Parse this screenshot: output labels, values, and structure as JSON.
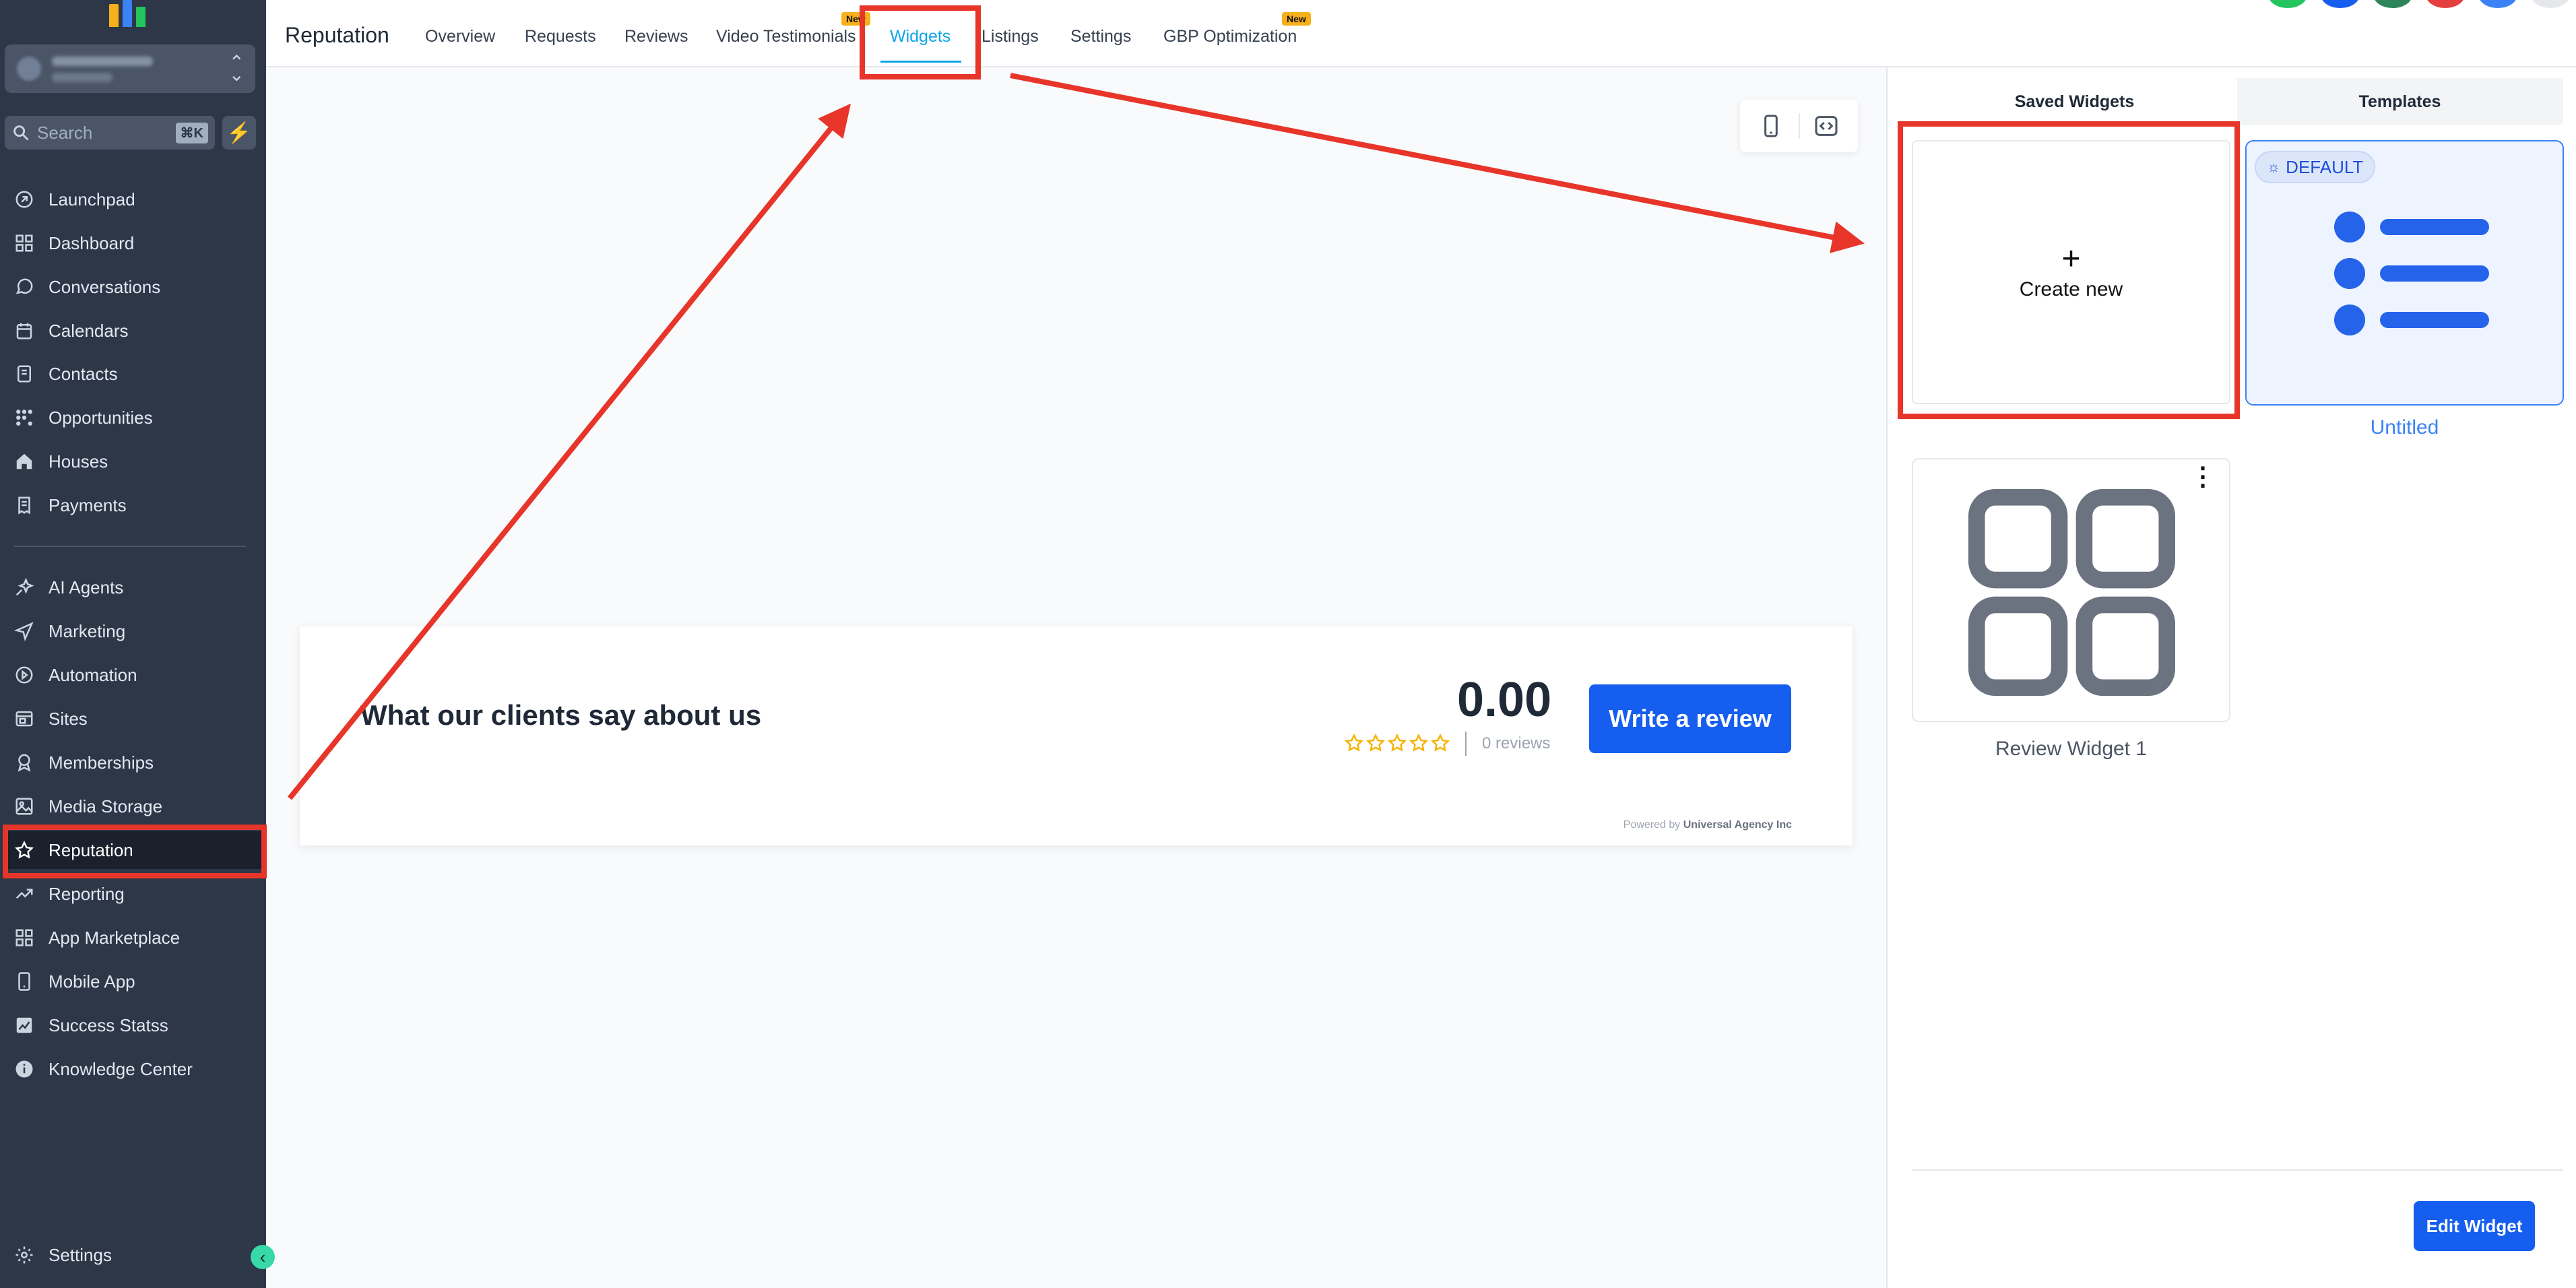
{
  "sidebar": {
    "search": {
      "placeholder": "Search",
      "shortcut": "⌘K"
    },
    "items": [
      {
        "label": "Launchpad",
        "icon": "rocket-icon"
      },
      {
        "label": "Dashboard",
        "icon": "grid-icon"
      },
      {
        "label": "Conversations",
        "icon": "chat-icon"
      },
      {
        "label": "Calendars",
        "icon": "calendar-icon"
      },
      {
        "label": "Contacts",
        "icon": "contact-book-icon"
      },
      {
        "label": "Opportunities",
        "icon": "pipeline-icon"
      },
      {
        "label": "Houses",
        "icon": "house-icon"
      },
      {
        "label": "Payments",
        "icon": "receipt-icon"
      },
      {
        "label": "AI Agents",
        "icon": "sparkle-icon"
      },
      {
        "label": "Marketing",
        "icon": "send-icon"
      },
      {
        "label": "Automation",
        "icon": "automation-icon"
      },
      {
        "label": "Sites",
        "icon": "sites-icon"
      },
      {
        "label": "Memberships",
        "icon": "award-icon"
      },
      {
        "label": "Media Storage",
        "icon": "image-icon"
      },
      {
        "label": "Reputation",
        "icon": "star-icon"
      },
      {
        "label": "Reporting",
        "icon": "trend-icon"
      },
      {
        "label": "App Marketplace",
        "icon": "apps-icon"
      },
      {
        "label": "Mobile App",
        "icon": "phone-icon"
      },
      {
        "label": "Success Statss",
        "icon": "chart-icon"
      },
      {
        "label": "Knowledge Center",
        "icon": "info-icon"
      }
    ],
    "settings_label": "Settings"
  },
  "header": {
    "title": "Reputation",
    "tabs": [
      {
        "label": "Overview"
      },
      {
        "label": "Requests"
      },
      {
        "label": "Reviews"
      },
      {
        "label": "Video Testimonials",
        "badge": "New"
      },
      {
        "label": "Widgets",
        "active": true
      },
      {
        "label": "Listings"
      },
      {
        "label": "Settings"
      },
      {
        "label": "GBP Optimization",
        "badge": "New"
      }
    ]
  },
  "preview": {
    "heading": "What our clients say about us",
    "score": "0.00",
    "reviews_count": "0 reviews",
    "cta": "Write a review",
    "powered_prefix": "Powered by",
    "powered_brand": "Universal Agency Inc"
  },
  "panel": {
    "tabs": [
      "Saved Widgets",
      "Templates"
    ],
    "create_label": "Create new",
    "create_symbol": "+",
    "template_badge": "DEFAULT",
    "template_name": "Untitled",
    "saved_widget_name": "Review Widget 1",
    "edit_button": "Edit Widget"
  },
  "colors": {
    "sidebar_bg": "#2d3748",
    "accent_blue": "#155eef",
    "active_tab": "#0ea5e9",
    "annotation_red": "#e8352a",
    "star": "#f5b301"
  }
}
